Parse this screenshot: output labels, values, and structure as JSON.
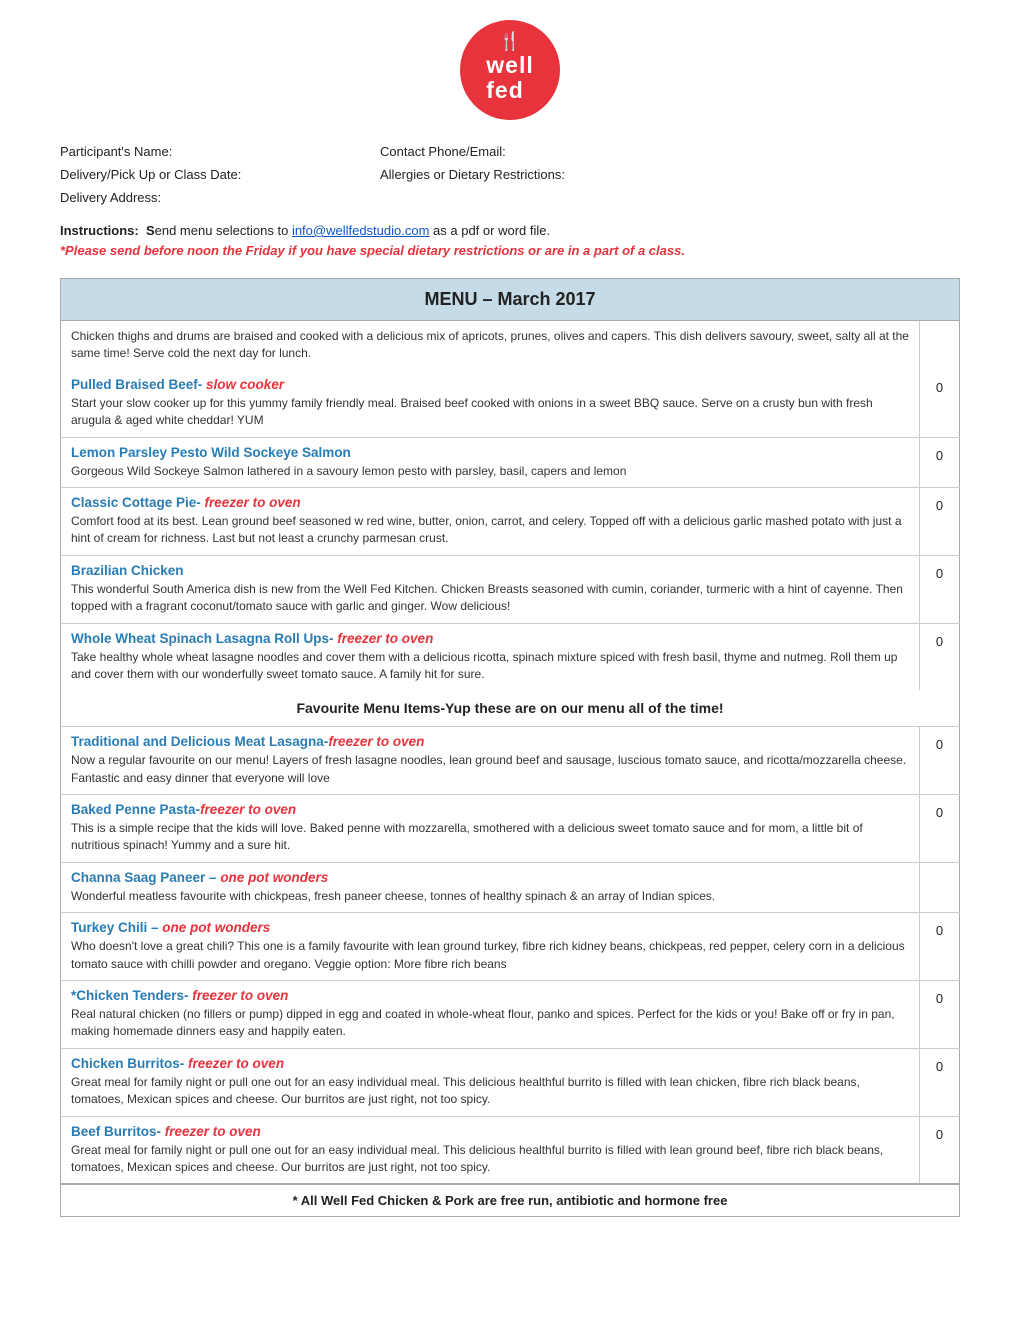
{
  "logo": {
    "line1": "well",
    "line2": "fed",
    "icon": "🍴"
  },
  "form": {
    "participant_label": "Participant's Name:",
    "contact_label": "Contact Phone/Email:",
    "delivery_label": "Delivery/Pick Up or Class Date:",
    "allergies_label": "Allergies or Dietary Restrictions:",
    "address_label": "Delivery Address:"
  },
  "instructions": {
    "prefix": "Instructions:  ",
    "bold_s": "S",
    "text": "end menu selections to ",
    "email": "info@wellfedstudio.com",
    "suffix": " as a pdf or word file.",
    "italic_notice": "*Please send before noon the Friday if you have special dietary restrictions or are in a part of a class."
  },
  "menu": {
    "title": "MENU – March 2017",
    "first_item_desc": "Chicken thighs and drums are braised and cooked with a delicious mix of apricots, prunes, olives and capers.  This dish delivers savoury, sweet, salty all at the same time! Serve cold the next day for lunch.",
    "items": [
      {
        "title": "Pulled Braised Beef-",
        "title_italic": " slow cooker",
        "desc": "Start your slow cooker up for this yummy family friendly meal. Braised beef cooked with onions in a sweet BBQ sauce.  Serve on a crusty bun with fresh arugula & aged white cheddar! YUM",
        "qty": "0"
      },
      {
        "title": "Lemon Parsley Pesto Wild Sockeye Salmon",
        "title_italic": "",
        "desc": "Gorgeous Wild Sockeye Salmon lathered in a savoury lemon pesto with parsley, basil, capers and lemon",
        "qty": "0"
      },
      {
        "title": "Classic Cottage Pie-",
        "title_italic": "  freezer to oven",
        "desc": "Comfort food at its best. Lean ground beef seasoned w red wine, butter, onion, carrot, and celery.  Topped off with a delicious garlic mashed potato with just a hint of cream for richness. Last but not least a crunchy parmesan crust.",
        "qty": "0"
      },
      {
        "title": "Brazilian Chicken",
        "title_italic": "",
        "desc": "This wonderful South America dish is new from the Well Fed Kitchen. Chicken Breasts seasoned with cumin, coriander, turmeric with a hint of cayenne. Then topped with a fragrant coconut/tomato sauce with garlic and ginger. Wow delicious!",
        "qty": "0"
      },
      {
        "title": "Whole Wheat Spinach Lasagna Roll Ups-",
        "title_italic": "  freezer to oven",
        "desc": "Take healthy whole wheat lasagne noodles and cover them with a delicious ricotta, spinach mixture spiced with fresh basil, thyme and nutmeg.  Roll them up and cover them with our wonderfully sweet tomato sauce. A family hit for sure.",
        "qty": "0"
      }
    ],
    "favourite_header": "Favourite Menu Items-Yup these are on our menu all of the time!",
    "favourites": [
      {
        "title": "Traditional and Delicious Meat Lasagna-",
        "title_italic": "freezer to oven",
        "desc": "Now a regular favourite on our menu! Layers of fresh lasagne noodles, lean ground beef and sausage, luscious tomato sauce, and ricotta/mozzarella cheese. Fantastic and easy dinner that everyone will love",
        "qty": "0"
      },
      {
        "title": "Baked Penne Pasta-",
        "title_italic": "freezer to oven",
        "desc": "This is a simple recipe that the kids will love.  Baked penne with mozzarella, smothered with a delicious sweet tomato sauce and for mom, a little bit of nutritious spinach! Yummy and a sure hit.",
        "qty": "0"
      },
      {
        "title": "Channa Saag Paneer –",
        "title_italic": " one pot wonders",
        "desc": "Wonderful meatless favourite with chickpeas, fresh paneer cheese, tonnes of healthy spinach & an array of Indian spices.",
        "qty": null
      },
      {
        "title": "Turkey Chili –",
        "title_italic": " one pot wonders",
        "desc": "Who doesn't love a great chili? This one is a family favourite with lean ground turkey, fibre rich kidney beans, chickpeas, red pepper, celery corn in a delicious tomato sauce with chilli powder and oregano. Veggie option: More fibre rich beans",
        "qty": "0"
      },
      {
        "title": "*Chicken Tenders-",
        "title_italic": " freezer to oven",
        "desc": "Real natural chicken (no fillers or pump) dipped in egg and coated in whole-wheat flour, panko and spices. Perfect for the kids or you! Bake off or fry in pan, making homemade dinners easy and happily eaten.",
        "qty": "0"
      },
      {
        "title": "Chicken Burritos-",
        "title_italic": " freezer to oven",
        "desc": "Great meal for family night or pull one out for an easy individual meal.  This delicious healthful burrito is filled with lean chicken, fibre rich black beans, tomatoes, Mexican spices and cheese.  Our burritos are just right, not too spicy.",
        "qty": "0"
      },
      {
        "title": "Beef Burritos-",
        "title_italic": " freezer to oven",
        "desc": "Great meal for family night or pull one out for an easy individual meal.  This delicious healthful burrito is filled with lean ground beef, fibre rich black beans, tomatoes, Mexican spices and cheese.  Our burritos are just right, not too spicy.",
        "qty": "0"
      }
    ],
    "footer": "* All Well Fed Chicken & Pork are free run, antibiotic and hormone free"
  }
}
